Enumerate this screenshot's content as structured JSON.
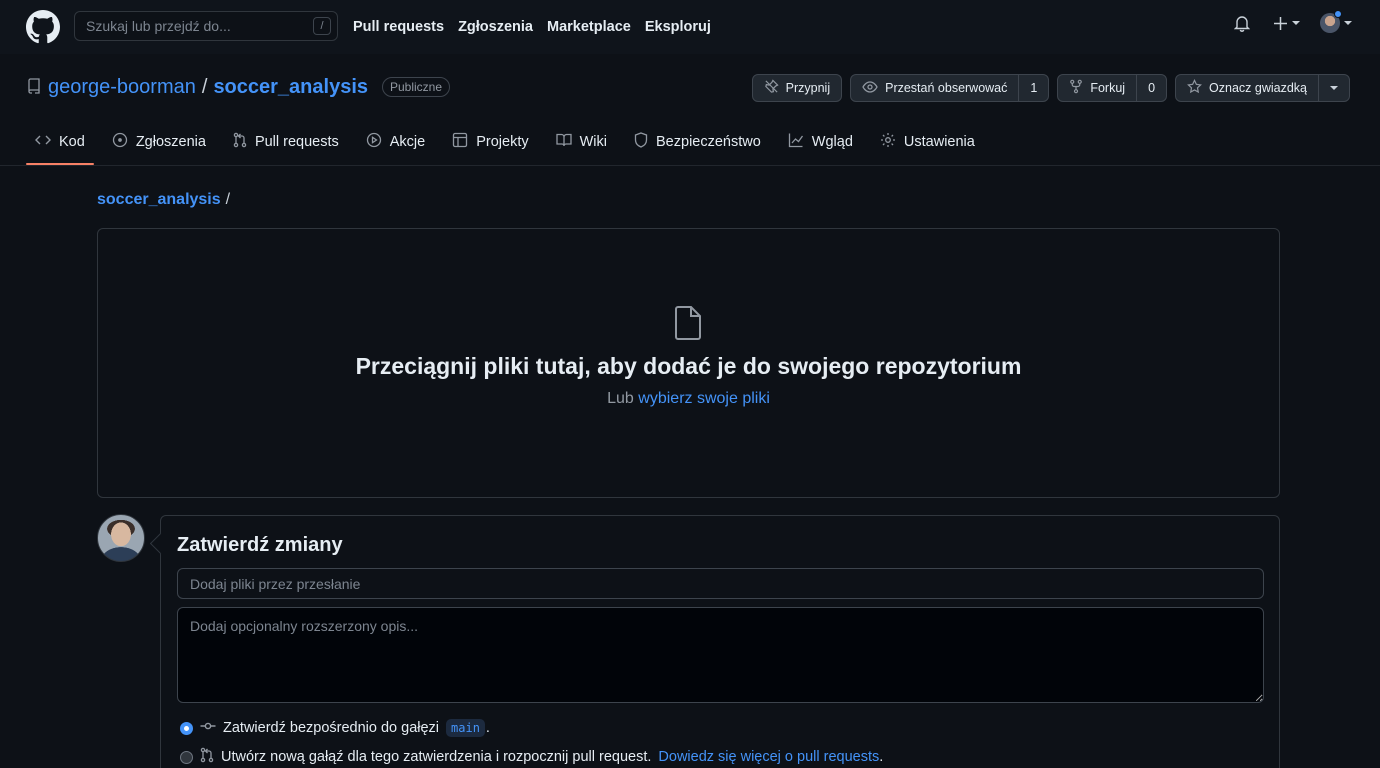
{
  "header": {
    "search_placeholder": "Szukaj lub przejdź do...",
    "search_shortcut": "/",
    "nav": [
      "Pull requests",
      "Zgłoszenia",
      "Marketplace",
      "Eksploruj"
    ]
  },
  "repo": {
    "owner": "george-boorman",
    "separator": "/",
    "name": "soccer_analysis",
    "visibility": "Publiczne",
    "actions": {
      "pin": "Przypnij",
      "unwatch": "Przestań obserwować",
      "watch_count": "1",
      "fork": "Forkuj",
      "fork_count": "0",
      "star": "Oznacz gwiazdką"
    }
  },
  "tabs": [
    {
      "label": "Kod",
      "icon": "code-icon"
    },
    {
      "label": "Zgłoszenia",
      "icon": "issue-icon"
    },
    {
      "label": "Pull requests",
      "icon": "pull-request-icon"
    },
    {
      "label": "Akcje",
      "icon": "play-icon"
    },
    {
      "label": "Projekty",
      "icon": "table-icon"
    },
    {
      "label": "Wiki",
      "icon": "book-icon"
    },
    {
      "label": "Bezpieczeństwo",
      "icon": "shield-icon"
    },
    {
      "label": "Wgląd",
      "icon": "graph-icon"
    },
    {
      "label": "Ustawienia",
      "icon": "gear-icon"
    }
  ],
  "breadcrumb": {
    "repo": "soccer_analysis",
    "sep": "/"
  },
  "dropzone": {
    "title": "Przeciągnij pliki tutaj, aby dodać je do swojego repozytorium",
    "sub_prefix": "Lub",
    "sub_link": "wybierz swoje pliki"
  },
  "commit": {
    "title": "Zatwierdź zmiany",
    "summary_placeholder": "Dodaj pliki przez przesłanie",
    "description_placeholder": "Dodaj opcjonalny rozszerzony opis...",
    "option_direct": "Zatwierdź bezpośrednio do gałęzi",
    "branch": "main",
    "option_direct_suffix": ".",
    "option_new_branch": "Utwórz nową gałąź dla tego zatwierdzenia i rozpocznij pull request.",
    "learn_more": "Dowiedz się więcej o pull requests",
    "learn_more_suffix": "."
  },
  "colors": {
    "accent": "#4493f8",
    "active_tab_underline": "#f78166",
    "background": "#0d1117"
  }
}
